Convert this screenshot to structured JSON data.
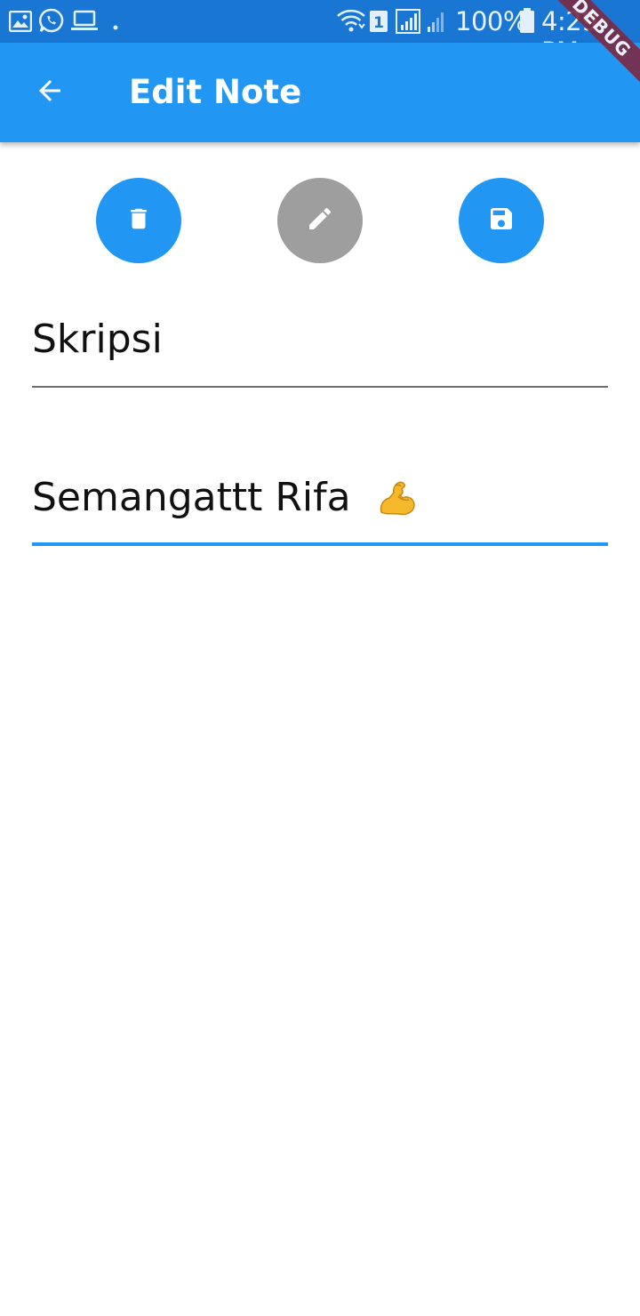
{
  "status_bar": {
    "battery": "100%",
    "time": "4:29 PM",
    "sim_slot": "1",
    "icons": [
      "gallery-icon",
      "whatsapp-icon",
      "laptop-icon",
      "dot-icon",
      "wifi-icon",
      "sim-icon",
      "signal-icon",
      "battery-icon"
    ]
  },
  "debug_banner": "DEBUG",
  "app_bar": {
    "title": "Edit Note",
    "color": "#2196f3",
    "back_icon": "arrow-back-icon"
  },
  "actions": [
    {
      "name": "delete",
      "icon": "trash-icon",
      "color": "#2196f3"
    },
    {
      "name": "edit",
      "icon": "pencil-icon",
      "color": "#9e9e9e"
    },
    {
      "name": "save",
      "icon": "floppy-disk-icon",
      "color": "#2196f3"
    }
  ],
  "note": {
    "title": "Skripsi",
    "body": "Semangattt Rifa",
    "body_emoji": "flexed-biceps-icon"
  }
}
